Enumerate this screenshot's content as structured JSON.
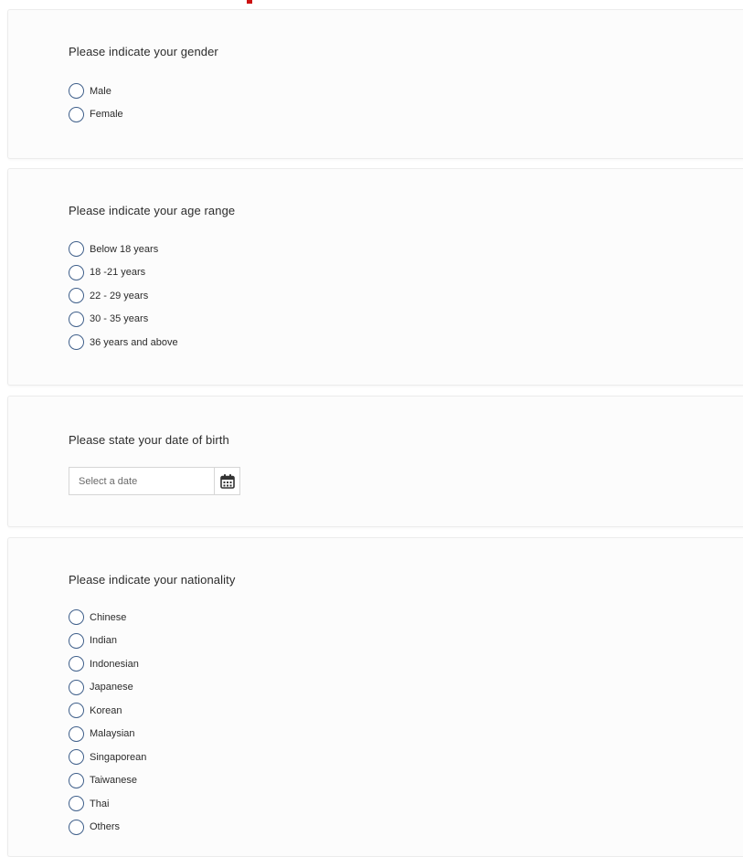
{
  "colors": {
    "radio_border": "#3f5f8a",
    "card_background": "#fcfcfc",
    "top_mark": "#cc1111"
  },
  "icons": {
    "radio": "radio-circle-icon",
    "calendar": "calendar-icon"
  },
  "gender": {
    "question": "Please indicate your gender",
    "options": [
      "Male",
      "Female"
    ]
  },
  "age": {
    "question": "Please indicate your age range",
    "options": [
      "Below 18 years",
      "18 -21 years",
      "22 - 29 years",
      "30 - 35 years",
      "36 years and above"
    ]
  },
  "dob": {
    "question": "Please state your date of birth",
    "placeholder": "Select a date"
  },
  "nationality": {
    "question": "Please indicate your nationality",
    "options": [
      "Chinese",
      "Indian",
      "Indonesian",
      "Japanese",
      "Korean",
      "Malaysian",
      "Singaporean",
      "Taiwanese",
      "Thai",
      "Others"
    ]
  }
}
